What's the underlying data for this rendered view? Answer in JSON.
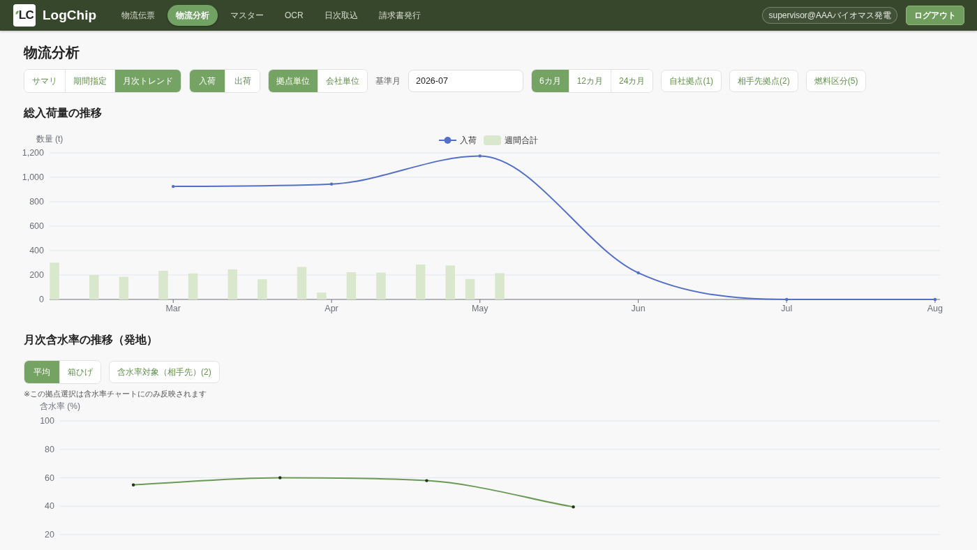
{
  "header": {
    "logo": {
      "mark": "LC",
      "name": "LogChip"
    },
    "nav": [
      {
        "label": "物流伝票",
        "selected": false
      },
      {
        "label": "物流分析",
        "selected": true
      },
      {
        "label": "マスター",
        "selected": false
      },
      {
        "label": "OCR",
        "selected": false
      },
      {
        "label": "日次取込",
        "selected": false
      },
      {
        "label": "請求書発行",
        "selected": false
      }
    ],
    "user": "supervisor@AAAバイオマス発電",
    "logout_button": "ログアウト"
  },
  "page_title": "物流分析",
  "toolbar": [
    {
      "kind": "segmented",
      "options": [
        {
          "label": "サマリ",
          "selected": false
        },
        {
          "label": "期間指定",
          "selected": false
        },
        {
          "label": "月次トレンド",
          "selected": true
        }
      ]
    },
    {
      "kind": "segmented",
      "options": [
        {
          "label": "入荷",
          "selected": true
        },
        {
          "label": "出荷",
          "selected": false
        }
      ]
    },
    {
      "kind": "segmented",
      "options": [
        {
          "label": "拠点単位",
          "selected": true
        },
        {
          "label": "会社単位",
          "selected": false
        }
      ]
    },
    {
      "kind": "field",
      "label": "基準月",
      "value": "2026-07"
    },
    {
      "kind": "segmented",
      "options": [
        {
          "label": "6カ月",
          "selected": true
        },
        {
          "label": "12カ月",
          "selected": false
        },
        {
          "label": "24カ月",
          "selected": false
        }
      ]
    },
    {
      "kind": "button",
      "label": "自社拠点(1)"
    },
    {
      "kind": "button",
      "label": "相手先拠点(2)"
    },
    {
      "kind": "button",
      "label": "燃料区分(5)"
    }
  ],
  "inbound_section": {
    "title": "総入荷量の推移",
    "chart_data": {
      "type": "line",
      "ylabel": "数量 (t)",
      "grid": true,
      "legend": "top",
      "categories": [
        null,
        null,
        null,
        null,
        null,
        null,
        null,
        null,
        null,
        null,
        null,
        null,
        "Mar",
        null,
        null,
        null,
        null,
        null,
        null,
        null,
        null,
        null,
        null,
        null,
        null,
        null,
        null,
        null,
        "Apr",
        null,
        null,
        null,
        null,
        null,
        null,
        null,
        null,
        null,
        null,
        null,
        null,
        null,
        null,
        "May",
        null,
        null,
        null,
        null,
        null,
        null,
        null,
        null,
        null,
        null,
        null,
        null,
        null,
        null,
        null,
        "Jun",
        null,
        null,
        null,
        null,
        null,
        null,
        null,
        null,
        null,
        null,
        null,
        null,
        null,
        null,
        "Jul",
        null,
        null,
        null,
        null,
        null,
        null,
        null,
        null,
        null,
        null,
        null,
        null,
        null,
        null,
        "Aug"
      ],
      "ylim": [
        0,
        1200
      ],
      "yticks": [
        0,
        200,
        400,
        600,
        800,
        {
          "value": 1000,
          "label": "1,000"
        },
        {
          "value": 1200,
          "label": "1,200"
        }
      ],
      "series": [
        {
          "name": "入荷",
          "color": "#5470c6",
          "values": [
            null,
            null,
            null,
            null,
            null,
            null,
            null,
            null,
            null,
            null,
            null,
            null,
            925,
            null,
            null,
            null,
            null,
            null,
            null,
            null,
            null,
            null,
            null,
            null,
            null,
            null,
            null,
            null,
            944,
            null,
            null,
            null,
            null,
            null,
            null,
            null,
            null,
            null,
            null,
            null,
            null,
            null,
            null,
            1174,
            null,
            null,
            null,
            null,
            null,
            null,
            null,
            null,
            null,
            null,
            null,
            null,
            null,
            null,
            null,
            218,
            null,
            null,
            null,
            null,
            null,
            null,
            null,
            null,
            null,
            null,
            null,
            null,
            null,
            null,
            0,
            null,
            null,
            null,
            null,
            null,
            null,
            null,
            null,
            null,
            null,
            null,
            null,
            null,
            null,
            0
          ]
        },
        {
          "name": "週間合計",
          "type": "bar",
          "color": "#d9e7cd",
          "values": [
            301,
            null,
            null,
            null,
            200,
            null,
            null,
            185,
            null,
            null,
            null,
            235,
            null,
            null,
            213,
            null,
            null,
            null,
            246,
            null,
            null,
            165,
            null,
            null,
            null,
            266,
            null,
            56,
            null,
            null,
            223,
            null,
            null,
            220,
            null,
            null,
            null,
            286,
            null,
            null,
            278,
            null,
            167,
            null,
            null,
            215,
            null,
            null,
            null,
            null,
            null,
            null,
            null,
            null,
            null,
            null,
            null,
            null,
            null,
            null,
            null,
            null,
            null,
            null,
            null,
            null,
            null,
            null,
            null,
            null,
            null,
            null,
            null,
            null,
            null,
            null,
            null,
            null,
            null,
            null,
            null,
            null,
            null,
            null,
            null,
            null,
            null,
            null,
            null,
            null
          ]
        }
      ]
    }
  },
  "moisture_section": {
    "title": "月次含水率の推移（発地）",
    "toolbar": [
      {
        "kind": "segmented",
        "options": [
          {
            "label": "平均",
            "selected": true
          },
          {
            "label": "箱ひげ",
            "selected": false
          }
        ]
      },
      {
        "kind": "button",
        "label": "含水率対象（相手先）(2)"
      }
    ],
    "note": "※この拠点選択は含水率チャートにのみ反映されます",
    "chart_data": {
      "type": "line",
      "ylabel": "含水率 (%)",
      "grid": true,
      "categories": [
        null,
        null,
        null,
        null,
        null,
        null
      ],
      "ylim": [
        20,
        100
      ],
      "yticks": [
        20,
        40,
        60,
        80,
        100
      ],
      "series": [
        {
          "color": "#6a9a55",
          "values": [
            55,
            60,
            58,
            39.5,
            null,
            null
          ]
        }
      ]
    }
  }
}
